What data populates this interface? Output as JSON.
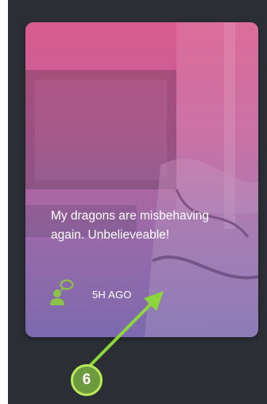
{
  "card": {
    "message": "My dragons are misbehaving again. Unbelieveable!",
    "timestamp": "5H AGO",
    "icons": {
      "author": "user-comment-icon"
    },
    "colors": {
      "gradient_top": "#d85b8e",
      "gradient_bottom": "#7c6aae",
      "icon": "#8bc34a"
    }
  },
  "annotation": {
    "step_number": "6",
    "colors": {
      "arrow": "#8bd63a",
      "badge_fill": "#6d9a3e",
      "badge_border": "#b9ea5a"
    }
  },
  "page": {
    "background": "#2b2f35"
  }
}
